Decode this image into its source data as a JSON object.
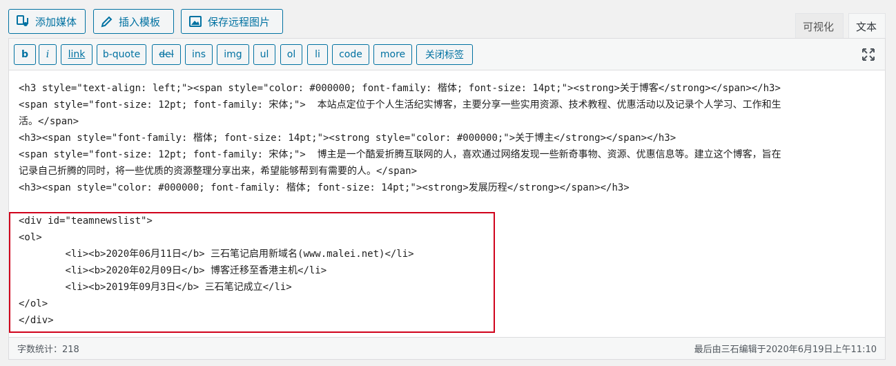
{
  "media_buttons": {
    "add_media": "添加媒体",
    "insert_template": "插入模板",
    "save_remote_images": "保存远程图片"
  },
  "mode_tabs": {
    "visual": "可视化",
    "text": "文本"
  },
  "quicktags": [
    {
      "label": "b",
      "style": "bold"
    },
    {
      "label": "i",
      "style": "italic"
    },
    {
      "label": "link",
      "style": "under"
    },
    {
      "label": "b-quote",
      "style": ""
    },
    {
      "label": "del",
      "style": "strike"
    },
    {
      "label": "ins",
      "style": ""
    },
    {
      "label": "img",
      "style": ""
    },
    {
      "label": "ul",
      "style": ""
    },
    {
      "label": "ol",
      "style": ""
    },
    {
      "label": "li",
      "style": ""
    },
    {
      "label": "code",
      "style": ""
    },
    {
      "label": "more",
      "style": ""
    },
    {
      "label": "关闭标签",
      "style": ""
    }
  ],
  "code_lines": [
    "<h3 style=\"text-align: left;\"><span style=\"color: #000000; font-family: 楷体; font-size: 14pt;\"><strong>关于博客</strong></span></h3>",
    "<span style=\"font-size: 12pt; font-family: 宋体;\">  本站点定位于个人生活纪实博客，主要分享一些实用资源、技术教程、优惠活动以及记录个人学习、工作和生",
    "活。</span>",
    "<h3><span style=\"font-family: 楷体; font-size: 14pt;\"><strong style=\"color: #000000;\">关于博主</strong></span></h3>",
    "<span style=\"font-size: 12pt; font-family: 宋体;\">  博主是一个酷爱折腾互联网的人，喜欢通过网络发现一些新奇事物、资源、优惠信息等。建立这个博客，旨在",
    "记录自己折腾的同时，将一些优质的资源整理分享出来，希望能够帮到有需要的人。</span>",
    "<h3><span style=\"color: #000000; font-family: 楷体; font-size: 14pt;\"><strong>发展历程</strong></span></h3>",
    "",
    "<div id=\"teamnewslist\">",
    "<ol>",
    "        <li><b>2020年06月11日</b> 三石笔记启用新域名(www.malei.net)</li>",
    "        <li><b>2020年02月09日</b> 博客迁移至香港主机</li>",
    "        <li><b>2019年09月3日</b> 三石笔记成立</li>",
    "</ol>",
    "</div>"
  ],
  "status_bar": {
    "word_count": "字数统计：218",
    "last_edited": "最后由三石编辑于2020年6月19日上午11:10"
  },
  "colors": {
    "accent": "#0071a1",
    "highlight": "#d0021b"
  }
}
